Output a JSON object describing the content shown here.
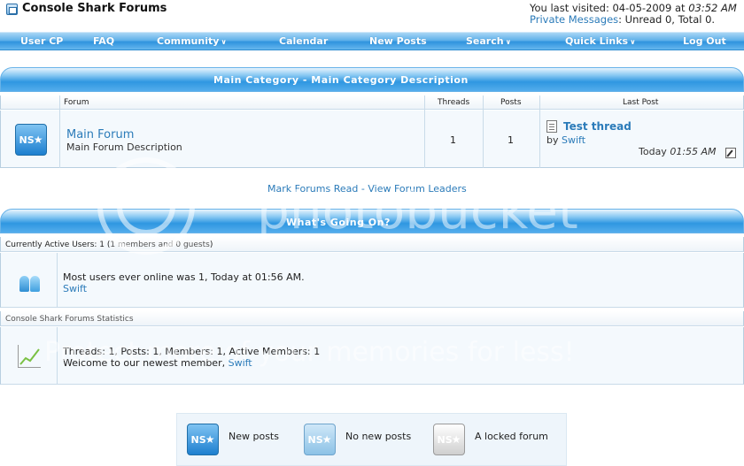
{
  "header": {
    "site_title": "Console Shark Forums",
    "last_visited_prefix": "You last visited: 04-05-2009 at",
    "last_visited_time": "03:52 AM",
    "pm_link": "Private Messages",
    "pm_status": ": Unread 0, Total 0."
  },
  "navbar": {
    "items": [
      {
        "label": "User CP"
      },
      {
        "label": "FAQ"
      },
      {
        "label": "Community",
        "dropdown": true
      },
      {
        "label": "Calendar"
      },
      {
        "label": "New Posts"
      },
      {
        "label": "Search",
        "dropdown": true
      },
      {
        "label": "Quick Links",
        "dropdown": true
      },
      {
        "label": "Log Out"
      }
    ]
  },
  "category": {
    "title": "Main Category - Main Category Description",
    "columns": [
      "Forum",
      "Threads",
      "Posts",
      "Last Post"
    ],
    "forums": [
      {
        "icon_text": "NS",
        "name": "Main Forum",
        "description": "Main Forum Description",
        "threads": "1",
        "posts": "1",
        "last_post_title": "Test thread",
        "last_post_by": "by",
        "last_post_user": "Swift",
        "last_post_day": "Today",
        "last_post_time": "01:55 AM"
      }
    ]
  },
  "links": {
    "mark_read": "Mark Forums Read",
    "separator": "-",
    "view_leaders": "View Forum Leaders"
  },
  "whats_going_on": {
    "title": "What's Going On?",
    "active_users_label": "Currently Active Users",
    "active_users_count": ": 1 (",
    "active_users_breakdown": "1 members and 0 guests",
    "active_users_close": ")",
    "most_online": "Most users ever online was 1, Today at 01:56 AM.",
    "online_user": "Swift",
    "stats_label": "Console Shark Forums Statistics",
    "stats_line": "Threads: 1, Posts: 1, Members: 1, Active Members: 1",
    "newest_member_prefix": "Welcome to our newest member,",
    "newest_member": "Swift"
  },
  "legend": {
    "items": [
      {
        "label": "New posts",
        "state": "new"
      },
      {
        "label": "No new posts",
        "state": "no"
      },
      {
        "label": "A locked forum",
        "state": "locked"
      }
    ]
  },
  "watermark": {
    "brand": "photobucket",
    "tagline": "Protect more of your memories for less!"
  },
  "colors": {
    "accent": "#2f93de",
    "link": "#2b7bb9",
    "row_bg": "#f4f9fd"
  }
}
